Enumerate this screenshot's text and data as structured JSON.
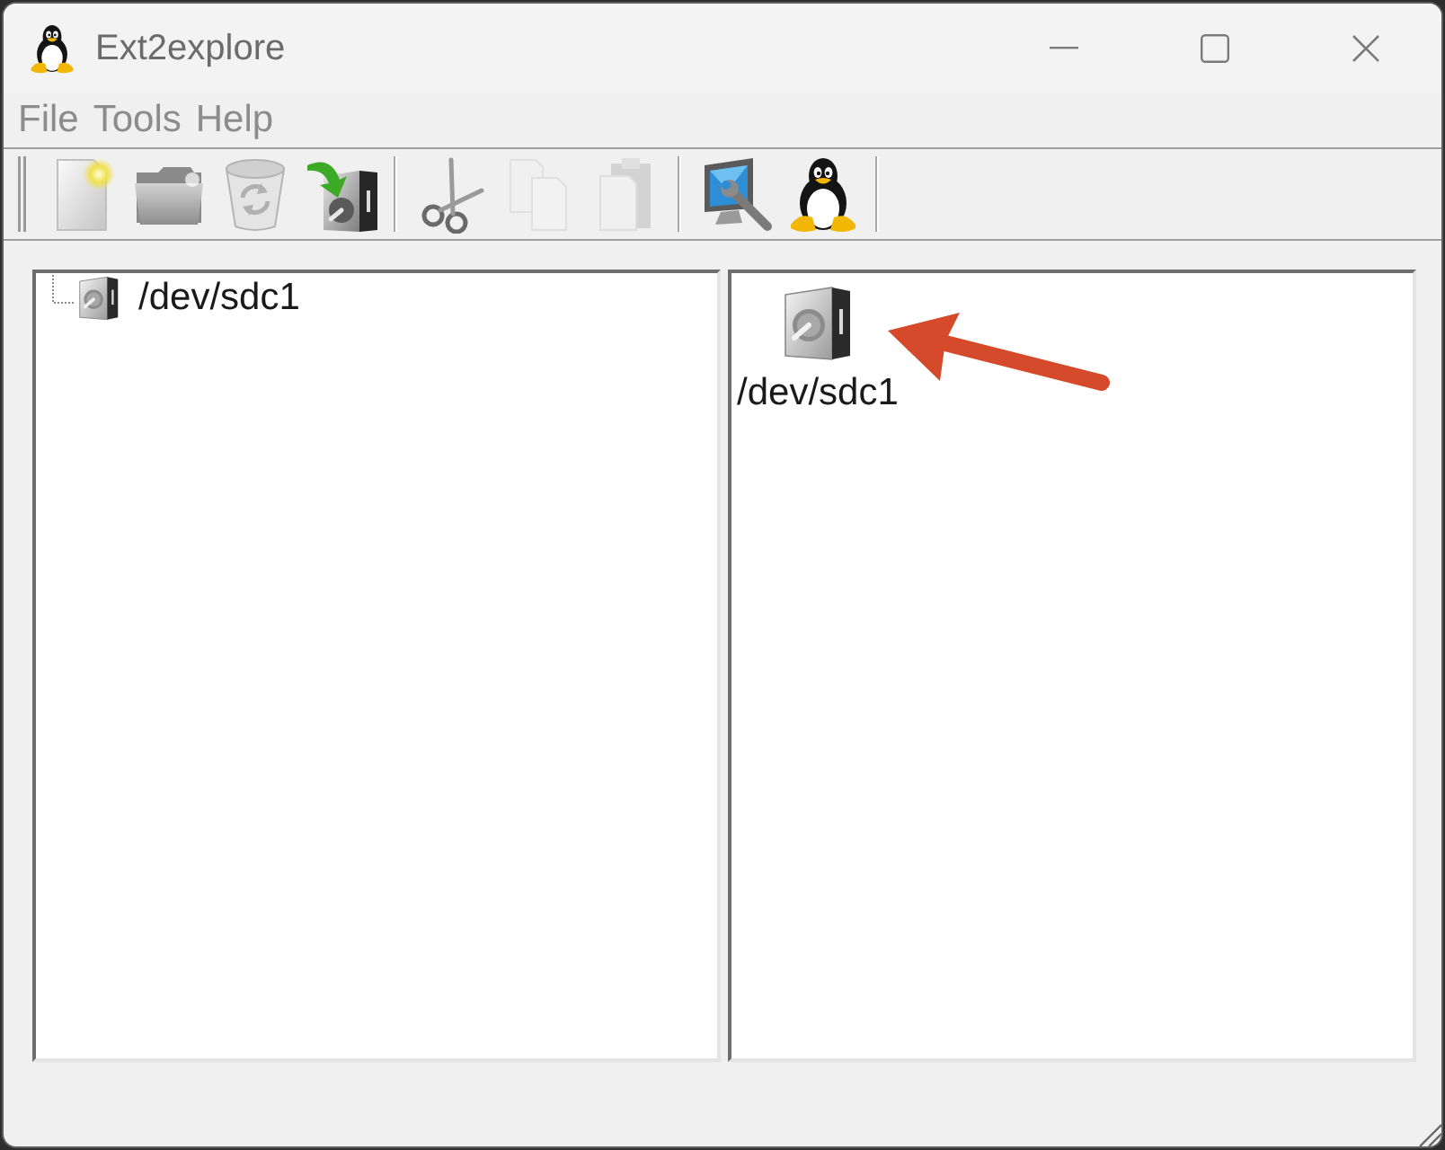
{
  "window": {
    "title": "Ext2explore"
  },
  "menu": [
    {
      "label": "File"
    },
    {
      "label": "Tools"
    },
    {
      "label": "Help"
    }
  ],
  "toolbar": [
    {
      "kind": "page",
      "disabled": false
    },
    {
      "kind": "folder",
      "disabled": false
    },
    {
      "kind": "bin",
      "disabled": false
    },
    {
      "kind": "import",
      "disabled": false
    },
    {
      "kind": "separator"
    },
    {
      "kind": "scissors",
      "disabled": false
    },
    {
      "kind": "copy",
      "disabled": true
    },
    {
      "kind": "clipboard",
      "disabled": true
    },
    {
      "kind": "separator"
    },
    {
      "kind": "monitor",
      "disabled": false
    },
    {
      "kind": "penguin",
      "disabled": false
    },
    {
      "kind": "separator"
    }
  ],
  "tree": {
    "items": [
      {
        "label": "/dev/sdc1"
      }
    ]
  },
  "files": {
    "items": [
      {
        "label": "/dev/sdc1"
      }
    ]
  }
}
